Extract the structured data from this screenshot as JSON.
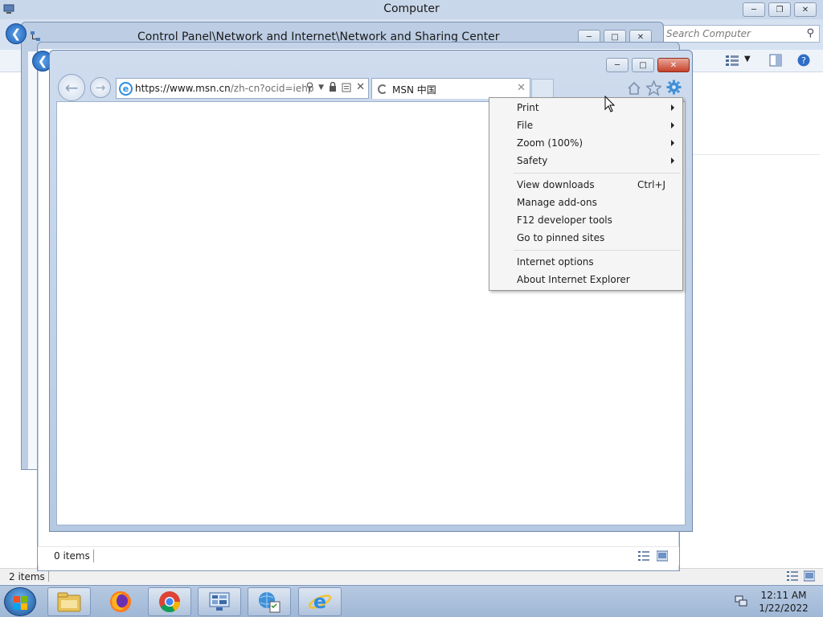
{
  "computer_window": {
    "title": "Computer",
    "search_placeholder": "Search Computer",
    "status_items": "2 items"
  },
  "control_panel_window": {
    "title": "Control Panel\\Network and Internet\\Network and Sharing Center"
  },
  "explorer_window": {
    "status_items": "0 items"
  },
  "ie_window": {
    "address": {
      "prefix": "https://www.",
      "host": "msn.cn",
      "path": "/zh-cn?ocid=iehp"
    },
    "tab": {
      "label": "MSN 中国"
    }
  },
  "tools_menu": {
    "items": [
      {
        "label": "Print",
        "submenu": true
      },
      {
        "label": "File",
        "submenu": true
      },
      {
        "label": "Zoom (100%)",
        "submenu": true
      },
      {
        "label": "Safety",
        "submenu": true
      },
      {
        "label": "View downloads",
        "shortcut": "Ctrl+J"
      },
      {
        "label": "Manage add-ons"
      },
      {
        "label": "F12 developer tools"
      },
      {
        "label": "Go to pinned sites"
      },
      {
        "label": "Internet options"
      },
      {
        "label": "About Internet Explorer"
      }
    ]
  },
  "taskbar": {
    "time": "12:11 AM",
    "date": "1/22/2022",
    "pinned": [
      "file-explorer-icon",
      "firefox-icon",
      "chrome-icon",
      "server-manager-icon",
      "network-settings-icon",
      "internet-explorer-icon"
    ]
  },
  "colors": {
    "title_bar": "#c9d7ea",
    "close_button": "#c7412a",
    "menu_background": "#f5f5f5",
    "taskbar": "#a9bfdc"
  }
}
